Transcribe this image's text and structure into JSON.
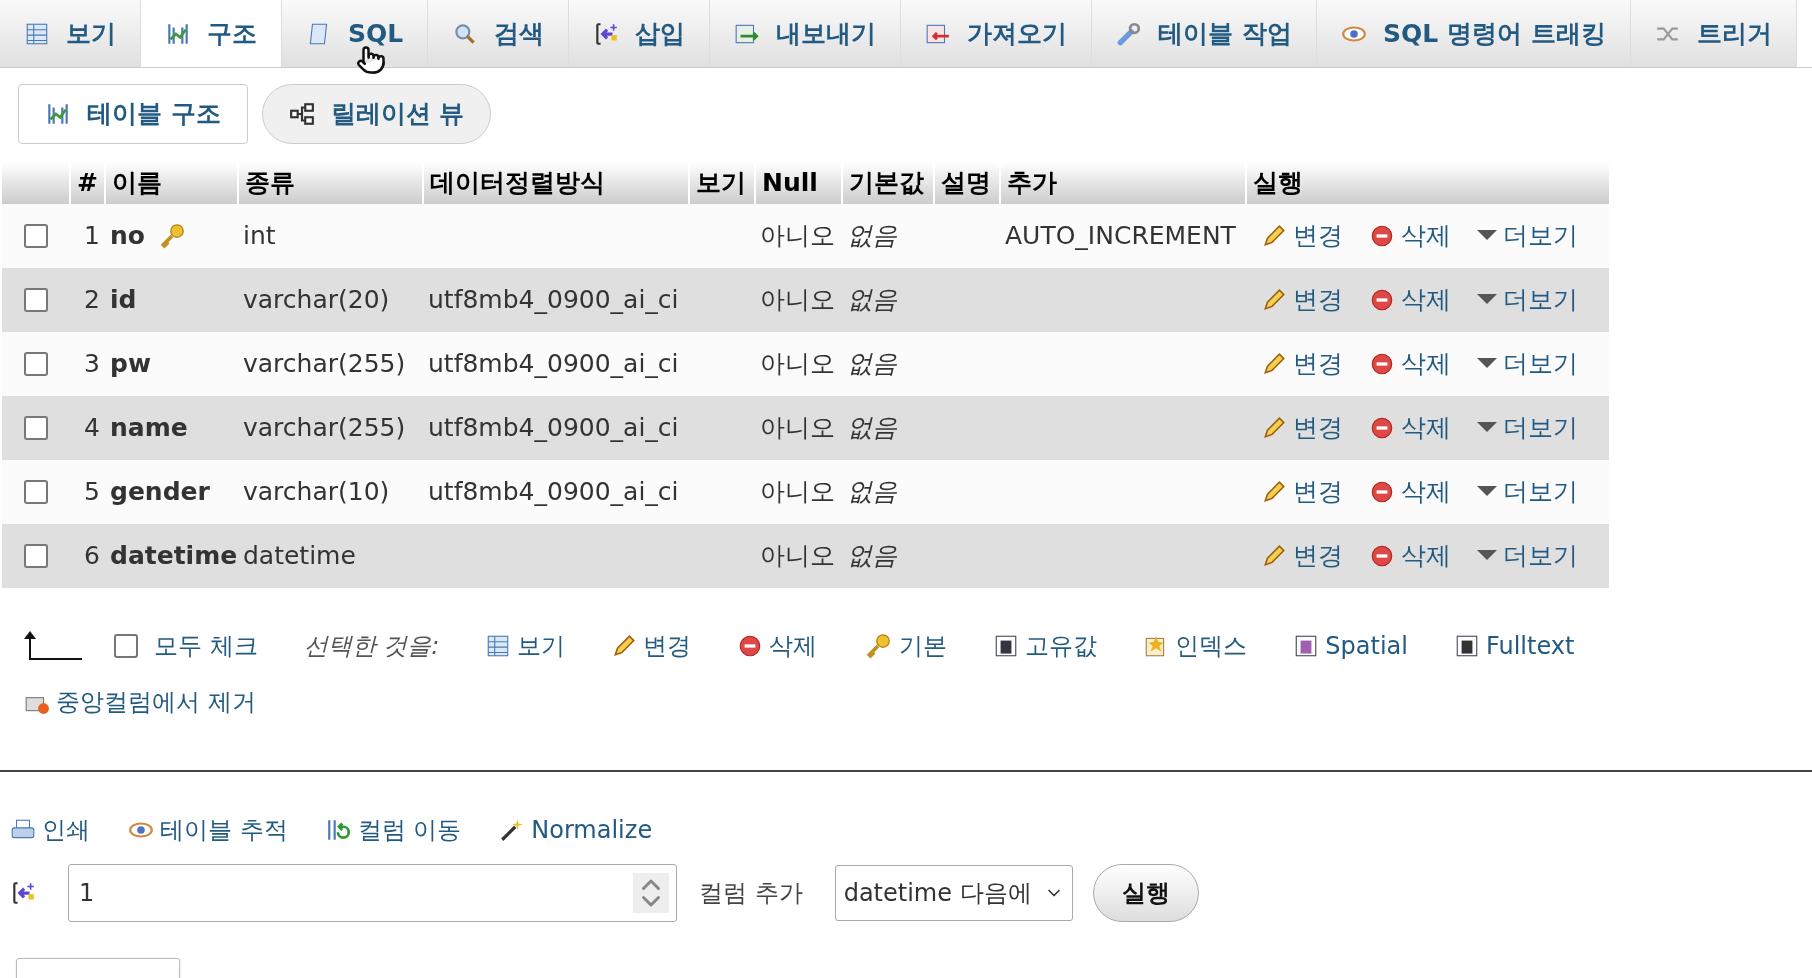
{
  "tabs": [
    {
      "label": "보기",
      "selected": false
    },
    {
      "label": "구조",
      "selected": true
    },
    {
      "label": "SQL",
      "selected": false
    },
    {
      "label": "검색",
      "selected": false
    },
    {
      "label": "삽입",
      "selected": false
    },
    {
      "label": "내보내기",
      "selected": false
    },
    {
      "label": "가져오기",
      "selected": false
    },
    {
      "label": "테이블 작업",
      "selected": false
    },
    {
      "label": "SQL 명령어 트래킹",
      "selected": false
    },
    {
      "label": "트리거",
      "selected": false
    }
  ],
  "subtabs": [
    {
      "label": "테이블 구조",
      "selected": true
    },
    {
      "label": "릴레이션 뷰",
      "selected": false
    }
  ],
  "table": {
    "columns": [
      "#",
      "이름",
      "종류",
      "데이터정렬방식",
      "보기",
      "Null",
      "기본값",
      "설명",
      "추가",
      "실행"
    ],
    "rows": [
      {
        "checked": false,
        "number": "1",
        "name": "no",
        "primary_key": true,
        "type": "int",
        "collation": "",
        "null": "아니오",
        "default": "없음",
        "extra": "AUTO_INCREMENT",
        "actions": [
          "변경",
          "삭제",
          "더보기"
        ]
      },
      {
        "checked": false,
        "number": "2",
        "name": "id",
        "primary_key": false,
        "type": "varchar(20)",
        "collation": "utf8mb4_0900_ai_ci",
        "null": "아니오",
        "default": "없음",
        "extra": "",
        "actions": [
          "변경",
          "삭제",
          "더보기"
        ]
      },
      {
        "checked": false,
        "number": "3",
        "name": "pw",
        "primary_key": false,
        "type": "varchar(255)",
        "collation": "utf8mb4_0900_ai_ci",
        "null": "아니오",
        "default": "없음",
        "extra": "",
        "actions": [
          "변경",
          "삭제",
          "더보기"
        ]
      },
      {
        "checked": false,
        "number": "4",
        "name": "name",
        "primary_key": false,
        "type": "varchar(255)",
        "collation": "utf8mb4_0900_ai_ci",
        "null": "아니오",
        "default": "없음",
        "extra": "",
        "actions": [
          "변경",
          "삭제",
          "더보기"
        ]
      },
      {
        "checked": false,
        "number": "5",
        "name": "gender",
        "primary_key": false,
        "type": "varchar(10)",
        "collation": "utf8mb4_0900_ai_ci",
        "null": "아니오",
        "default": "없음",
        "extra": "",
        "actions": [
          "변경",
          "삭제",
          "더보기"
        ]
      },
      {
        "checked": false,
        "number": "6",
        "name": "datetime",
        "primary_key": false,
        "type": "datetime",
        "collation": "",
        "null": "아니오",
        "default": "없음",
        "extra": "",
        "actions": [
          "변경",
          "삭제",
          "더보기"
        ]
      }
    ]
  },
  "bulk": {
    "check_all": {
      "label": "모두 체크",
      "checked": false
    },
    "with_selected": "선택한 것을:",
    "actions": [
      "보기",
      "변경",
      "삭제",
      "기본",
      "고유값",
      "인덱스",
      "Spatial",
      "Fulltext",
      "중앙컬럼에서 제거"
    ]
  },
  "links": [
    "인쇄",
    "테이블 추적",
    "컬럼 이동",
    "Normalize"
  ],
  "add_column": {
    "count": "1",
    "label": "컬럼 추가",
    "position": "datetime 다음에",
    "button": "실행"
  }
}
